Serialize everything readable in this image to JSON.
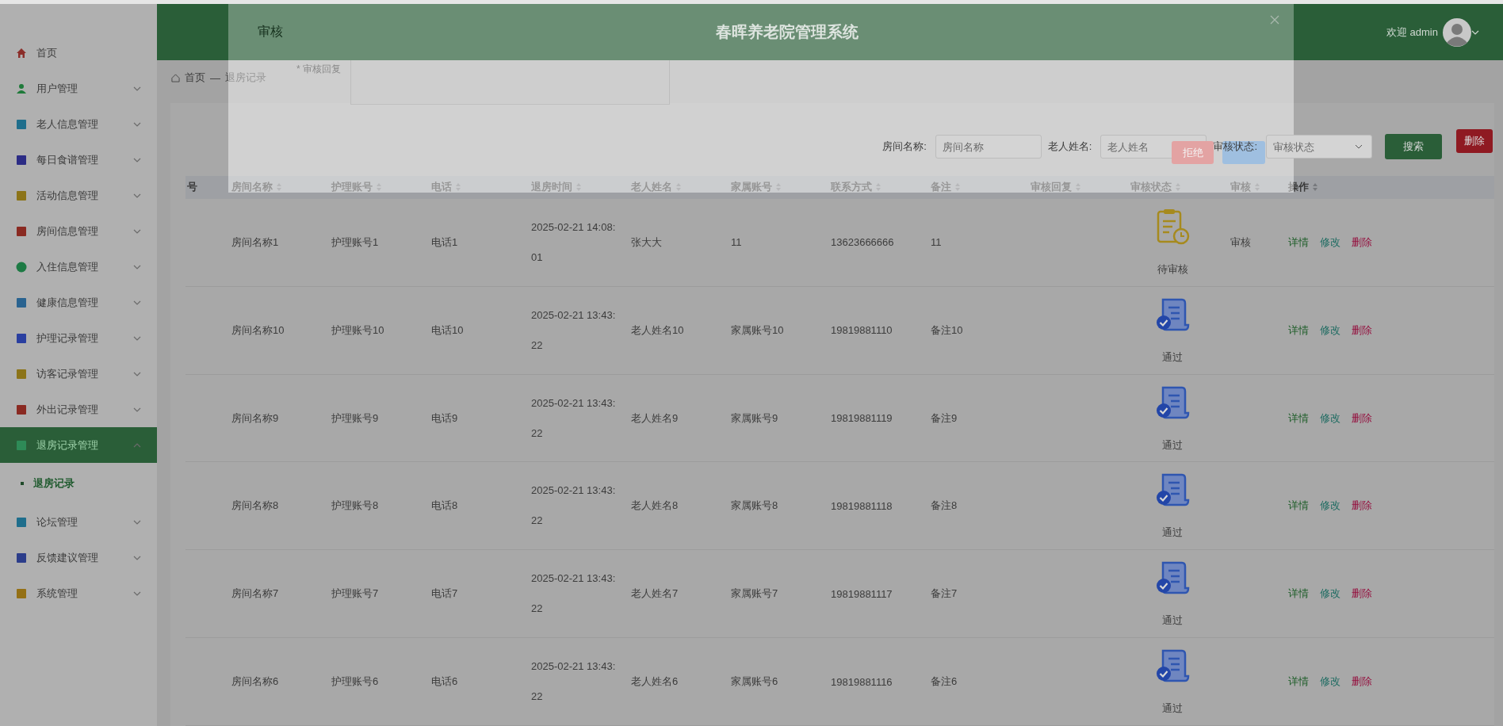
{
  "header": {
    "title": "春晖养老院管理系统",
    "welcome": "欢迎 admin"
  },
  "sidebar": {
    "items": [
      {
        "label": "首页",
        "color": "#8b2e2a",
        "selected": false
      },
      {
        "label": "用户管理",
        "color": "#1f7a3a",
        "expanded": false,
        "selected": false
      },
      {
        "label": "老人信息管理",
        "color": "#1f6e8c",
        "expanded": false,
        "selected": false
      },
      {
        "label": "每日食谱管理",
        "color": "#2c2c85",
        "expanded": false,
        "selected": false
      },
      {
        "label": "活动信息管理",
        "color": "#8c7419",
        "expanded": false,
        "selected": false
      },
      {
        "label": "房间信息管理",
        "color": "#8a2a22",
        "expanded": false,
        "selected": false
      },
      {
        "label": "入住信息管理",
        "color": "#1d7a44",
        "expanded": false,
        "selected": false
      },
      {
        "label": "健康信息管理",
        "color": "#2a6390",
        "expanded": false,
        "selected": false
      },
      {
        "label": "护理记录管理",
        "color": "#2a3fa0",
        "expanded": false,
        "selected": false
      },
      {
        "label": "访客记录管理",
        "color": "#8c7419",
        "expanded": false,
        "selected": false
      },
      {
        "label": "外出记录管理",
        "color": "#8a2a22",
        "expanded": false,
        "selected": false
      },
      {
        "label": "退房记录管理",
        "color": "#2e8b57",
        "expanded": true,
        "selected": true,
        "children": [
          {
            "label": "退房记录",
            "selected": true
          }
        ]
      },
      {
        "label": "论坛管理",
        "color": "#1f6e8c",
        "expanded": false,
        "selected": false
      },
      {
        "label": "反馈建议管理",
        "color": "#2c3d8a",
        "expanded": false,
        "selected": false
      },
      {
        "label": "系统管理",
        "color": "#947015",
        "expanded": false,
        "selected": false
      }
    ]
  },
  "breadcrumb": {
    "items": [
      "首页",
      "退房记录"
    ],
    "separator": "—"
  },
  "search": {
    "fields": [
      {
        "kind": "input",
        "label": "房间名称:",
        "placeholder": "房间名称"
      },
      {
        "kind": "input",
        "label": "老人姓名:",
        "placeholder": "老人姓名"
      },
      {
        "kind": "select",
        "label": "审核状态:",
        "placeholder": "审核状态"
      }
    ],
    "search_button": "搜索",
    "delete_button": "删除"
  },
  "table": {
    "columns": [
      {
        "label": "号",
        "sortable": false
      },
      {
        "label": "房间名称",
        "sortable": true
      },
      {
        "label": "护理账号",
        "sortable": true
      },
      {
        "label": "电话",
        "sortable": true
      },
      {
        "label": "退房时间",
        "sortable": true
      },
      {
        "label": "老人姓名",
        "sortable": true
      },
      {
        "label": "家属账号",
        "sortable": true
      },
      {
        "label": "联系方式",
        "sortable": true
      },
      {
        "label": "备注",
        "sortable": true
      },
      {
        "label": "审核回复",
        "sortable": true
      },
      {
        "label": "审核状态",
        "sortable": true
      },
      {
        "label": "审核",
        "sortable": true
      },
      {
        "label": "操作",
        "sortable": true
      }
    ],
    "rows": [
      {
        "room_name": "房间名称1",
        "nurse_account": "护理账号1",
        "phone": "电话1",
        "checkout_time": "2025-02-21 14:08:01",
        "elder_name": "张大大",
        "family_account": "11",
        "contact": "13623666666",
        "remark": "11",
        "status": {
          "kind": "pending",
          "label": "待审核"
        },
        "review_link": "审核",
        "actions": [
          {
            "kind": "detail",
            "label": "详情"
          },
          {
            "kind": "edit",
            "label": "修改"
          },
          {
            "kind": "delete",
            "label": "删除"
          }
        ]
      },
      {
        "room_name": "房间名称10",
        "nurse_account": "护理账号10",
        "phone": "电话10",
        "checkout_time": "2025-02-21 13:43:22",
        "elder_name": "老人姓名10",
        "family_account": "家属账号10",
        "contact": "19819881110",
        "remark": "备注10",
        "status": {
          "kind": "approved",
          "label": "通过"
        },
        "actions": [
          {
            "kind": "detail",
            "label": "详情"
          },
          {
            "kind": "edit",
            "label": "修改"
          },
          {
            "kind": "delete",
            "label": "删除"
          }
        ]
      },
      {
        "room_name": "房间名称9",
        "nurse_account": "护理账号9",
        "phone": "电话9",
        "checkout_time": "2025-02-21 13:43:22",
        "elder_name": "老人姓名9",
        "family_account": "家属账号9",
        "contact": "19819881119",
        "remark": "备注9",
        "status": {
          "kind": "approved",
          "label": "通过"
        },
        "actions": [
          {
            "kind": "detail",
            "label": "详情"
          },
          {
            "kind": "edit",
            "label": "修改"
          },
          {
            "kind": "delete",
            "label": "删除"
          }
        ]
      },
      {
        "room_name": "房间名称8",
        "nurse_account": "护理账号8",
        "phone": "电话8",
        "checkout_time": "2025-02-21 13:43:22",
        "elder_name": "老人姓名8",
        "family_account": "家属账号8",
        "contact": "19819881118",
        "remark": "备注8",
        "status": {
          "kind": "approved",
          "label": "通过"
        },
        "actions": [
          {
            "kind": "detail",
            "label": "详情"
          },
          {
            "kind": "edit",
            "label": "修改"
          },
          {
            "kind": "delete",
            "label": "删除"
          }
        ]
      },
      {
        "room_name": "房间名称7",
        "nurse_account": "护理账号7",
        "phone": "电话7",
        "checkout_time": "2025-02-21 13:43:22",
        "elder_name": "老人姓名7",
        "family_account": "家属账号7",
        "contact": "19819881117",
        "remark": "备注7",
        "status": {
          "kind": "approved",
          "label": "通过"
        },
        "actions": [
          {
            "kind": "detail",
            "label": "详情"
          },
          {
            "kind": "edit",
            "label": "修改"
          },
          {
            "kind": "delete",
            "label": "删除"
          }
        ]
      },
      {
        "room_name": "房间名称6",
        "nurse_account": "护理账号6",
        "phone": "电话6",
        "checkout_time": "2025-02-21 13:43:22",
        "elder_name": "老人姓名6",
        "family_account": "家属账号6",
        "contact": "19819881116",
        "remark": "备注6",
        "status": {
          "kind": "approved",
          "label": "通过"
        },
        "actions": [
          {
            "kind": "detail",
            "label": "详情"
          },
          {
            "kind": "edit",
            "label": "修改"
          },
          {
            "kind": "delete",
            "label": "删除"
          }
        ]
      }
    ]
  },
  "dialog": {
    "title": "审核",
    "field_label": "* 审核回复",
    "buttons": [
      {
        "kind": "reject",
        "label": "拒绝"
      },
      {
        "kind": "confirm"
      }
    ]
  }
}
